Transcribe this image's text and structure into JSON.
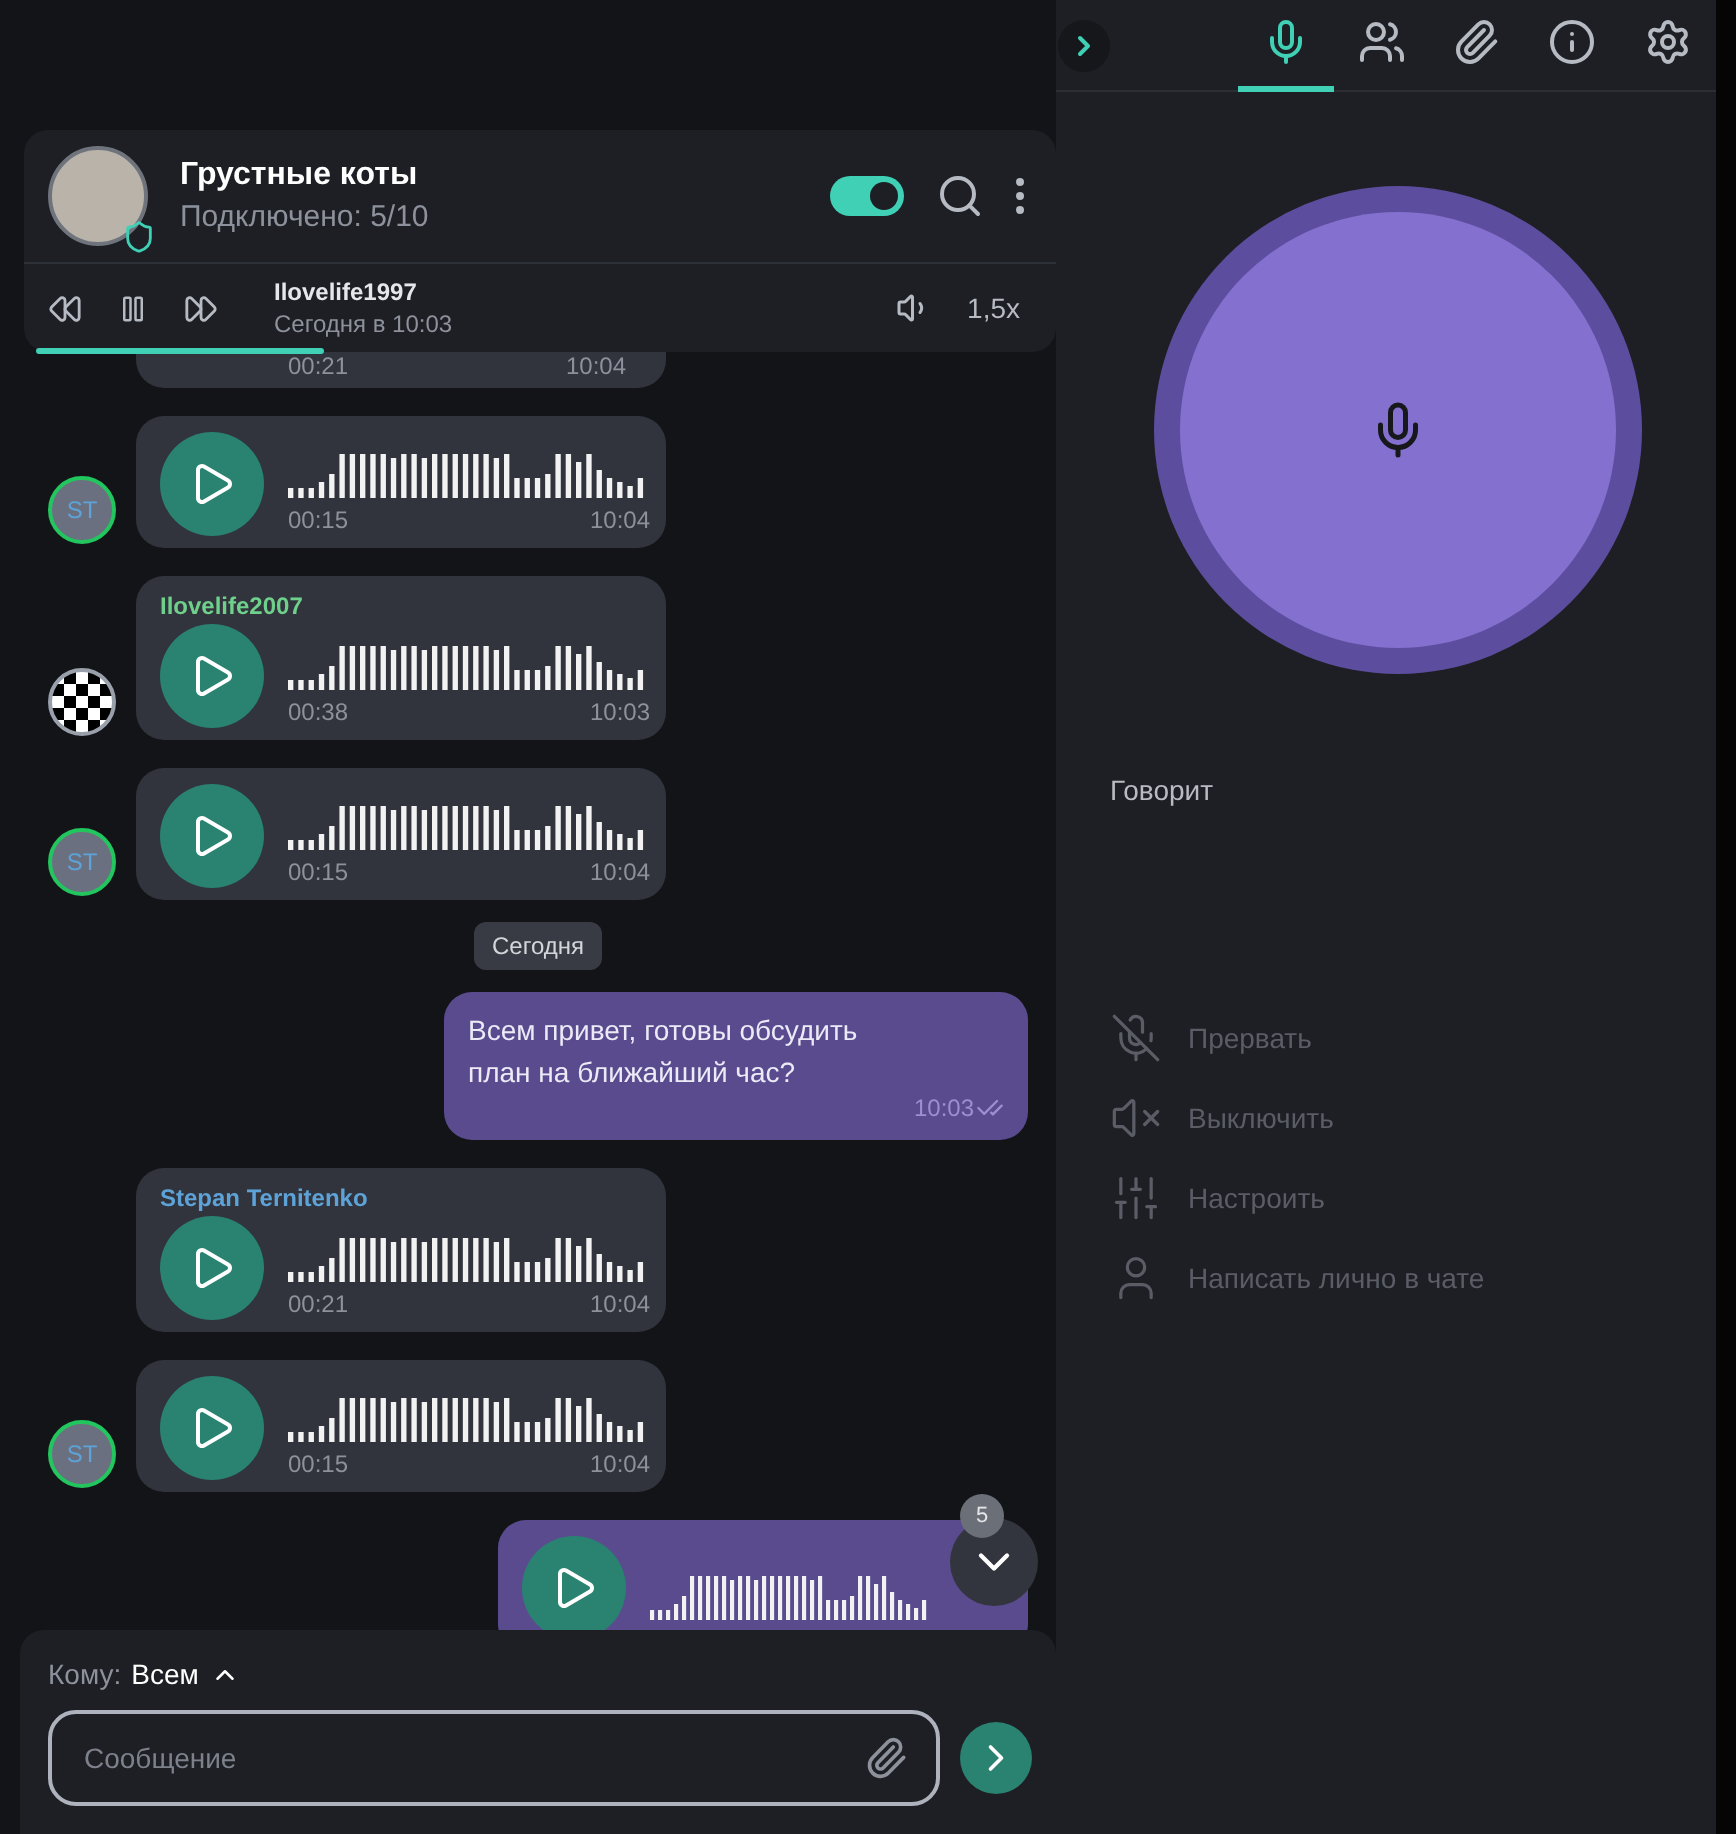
{
  "chat": {
    "title": "Грустные коты",
    "subtitle": "Подключено: 5/10",
    "verified": true,
    "toggle_on": true
  },
  "player": {
    "author": "Ilovelife1997",
    "time": "Сегодня в 10:03",
    "speed": "1,5x",
    "level": 0.29
  },
  "messages": [
    {
      "kind": "voice_tail",
      "outgoing": false,
      "duration": "00:21",
      "time": "10:04"
    },
    {
      "kind": "voice",
      "outgoing": false,
      "avatar": {
        "kind": "initials",
        "text": "ST",
        "color": "#22c55e"
      },
      "duration": "00:15",
      "time": "10:04"
    },
    {
      "kind": "voice",
      "outgoing": false,
      "sender": "Ilovelife2007",
      "color": "#6fd08c",
      "avatar": {
        "kind": "pattern",
        "color": "#9aa0ab"
      },
      "duration": "00:38",
      "time": "10:03"
    },
    {
      "kind": "voice",
      "outgoing": false,
      "avatar": {
        "kind": "initials",
        "text": "ST",
        "color": "#22c55e"
      },
      "duration": "00:15",
      "time": "10:04"
    },
    {
      "kind": "date",
      "text": "Сегодня"
    },
    {
      "kind": "text",
      "outgoing": true,
      "text": "Всем привет, готовы обсудить план на ближайший час?",
      "time": "10:03",
      "read": true
    },
    {
      "kind": "voice",
      "outgoing": false,
      "sender": "Stepan Ternitenko",
      "color": "#5ea3d8",
      "duration": "00:21",
      "time": "10:04"
    },
    {
      "kind": "voice",
      "outgoing": false,
      "avatar": {
        "kind": "initials",
        "text": "ST",
        "color": "#22c55e"
      },
      "duration": "00:15",
      "time": "10:04"
    },
    {
      "kind": "voice",
      "outgoing": true
    }
  ],
  "scroll_down": {
    "badge": "5"
  },
  "composer": {
    "to_label": "Кому:",
    "to_value": "Всем",
    "placeholder": "Сообщение"
  },
  "side_panel": {
    "tabs": [
      {
        "kind": "microphone",
        "selected": true
      },
      {
        "kind": "participants",
        "selected": false
      },
      {
        "kind": "attachments",
        "selected": false
      },
      {
        "kind": "info",
        "selected": false
      },
      {
        "kind": "settings",
        "selected": false
      }
    ],
    "speaking_label": "Говорит",
    "actions": [
      {
        "kind": "interrupt",
        "label": "Прервать"
      },
      {
        "kind": "mute",
        "label": "Выключить"
      },
      {
        "kind": "adjust",
        "label": "Настроить"
      },
      {
        "kind": "message",
        "label": "Написать лично в чате"
      }
    ]
  }
}
